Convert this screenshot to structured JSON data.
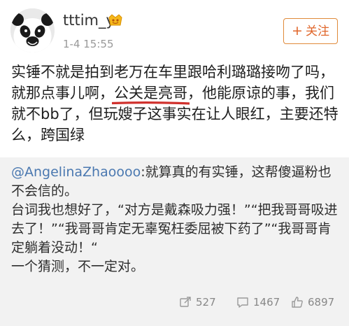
{
  "post": {
    "username": "tttim_y",
    "timestamp": "1-4 15:55",
    "follow_button": {
      "icon": "plus-icon",
      "plus": "+",
      "label": "关注"
    },
    "text_before": "实锤不就是拍到老万在车里跟哈利璐璐接吻了吗，就那点事儿啊，",
    "text_highlight": "公关是亮哥",
    "text_after": "，他能原谅的事，我们就不bb了，但玩嫂子这事实在让人眼红，主要还特么，跨国绿",
    "highlight_color": "#d0312d"
  },
  "repost": {
    "mention": "@AngelinaZhaoooo",
    "lines": [
      ":就算真的有实锤，这帮傻逼粉也不会信的。",
      "台词我也想好了，“对方是戴森吸力强！”“把我哥哥吸进去了！”“我哥哥肯定无辜冤枉委屈被下药了”“我哥哥肯定躺着没动！“",
      "一个猜测，不一定对。"
    ],
    "stats": {
      "reposts": {
        "icon": "repost-icon",
        "count": "527"
      },
      "comments": {
        "icon": "comment-icon",
        "count": "1467"
      },
      "likes": {
        "icon": "like-icon",
        "count": "6897"
      }
    }
  },
  "colors": {
    "follow_accent": "#e0662a",
    "mention": "#4a78b0",
    "repost_background": "#f2f2f2"
  }
}
